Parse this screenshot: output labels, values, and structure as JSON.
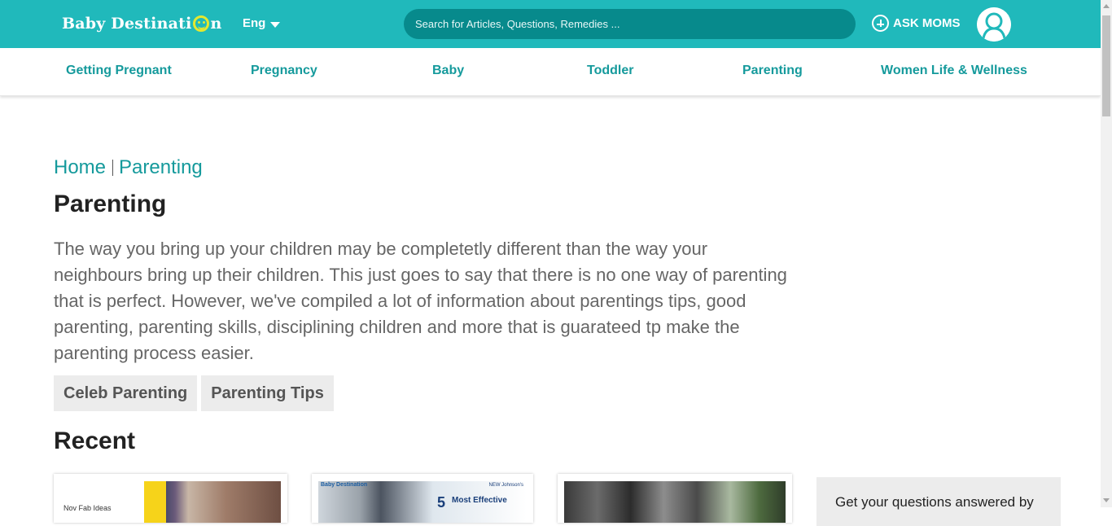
{
  "header": {
    "logo": {
      "text_before": "Baby Destinati",
      "text_after": "n"
    },
    "language": "Eng",
    "search_placeholder": "Search for Articles, Questions, Remedies ...",
    "ask_label": "ASK MOMS",
    "accent_color": "#20b9bb"
  },
  "nav": {
    "items": [
      {
        "label": "Getting Pregnant"
      },
      {
        "label": "Pregnancy"
      },
      {
        "label": "Baby"
      },
      {
        "label": "Toddler"
      },
      {
        "label": "Parenting"
      },
      {
        "label": "Women Life & Wellness"
      }
    ]
  },
  "breadcrumb": {
    "home": "Home",
    "current": "Parenting"
  },
  "page": {
    "title": "Parenting",
    "description": "The way you bring up your children may be completetly different than the way your neighbours bring up their children. This just goes to say that there is no one way of parenting that is perfect. However, we've compiled a lot of information about parentings tips, good parenting, parenting skills, disciplining children and more that is guarateed tp make the parenting process easier.",
    "tags": [
      {
        "label": "Celeb Parenting"
      },
      {
        "label": "Parenting Tips"
      }
    ],
    "recent_heading": "Recent"
  },
  "cards": [
    {
      "thumb_text": "Nov Fab Ideas"
    },
    {
      "brand": "Baby Destination",
      "number": "5",
      "thumb_text": "Most Effective",
      "badge": "NEW Johnson's"
    },
    {
      "thumb_text": ""
    }
  ],
  "sidebar": {
    "box_text": "Get your questions answered by"
  }
}
